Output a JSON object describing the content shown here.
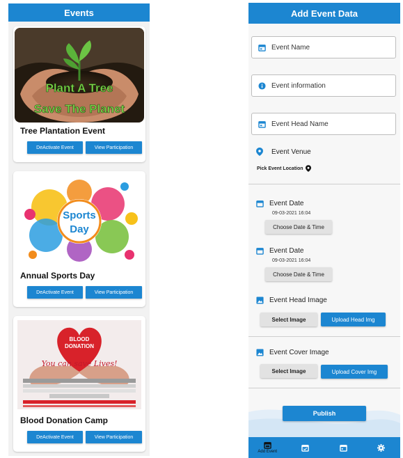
{
  "events_screen": {
    "title": "Events",
    "cards": [
      {
        "title": "Tree Plantation Event",
        "image_text_1": "Plant A Tree",
        "image_text_2": "Save The Planet",
        "deactivate_label": "DeActivate Event",
        "view_label": "View Participation"
      },
      {
        "title": "Annual Sports Day",
        "image_text_1": "Sports",
        "image_text_2": "Day",
        "deactivate_label": "DeActivate Event",
        "view_label": "View Participation"
      },
      {
        "title": "Blood Donation Camp",
        "image_text_1": "BLOOD",
        "image_text_2": "DONATION",
        "image_text_3": "You can save Lives!",
        "deactivate_label": "DeActivate Event",
        "view_label": "View Participation"
      }
    ]
  },
  "add_event": {
    "title": "Add Event Data",
    "fields": {
      "event_name": "Event Name",
      "event_information": "Event information",
      "event_head_name": "Event Head Name"
    },
    "venue": {
      "label": "Event Venue",
      "pick_location": "Pick Event Location"
    },
    "event_date_1": {
      "label": "Event Date",
      "value": "09-03-2021 16:04",
      "button": "Choose Date & Time"
    },
    "event_date_2": {
      "label": "Event Date",
      "value": "09-03-2021 16:04",
      "button": "Choose Date & Time"
    },
    "head_image": {
      "label": "Event Head Image",
      "select": "Select Image",
      "upload": "Upload Head Img"
    },
    "cover_image": {
      "label": "Event Cover Image",
      "select": "Select Image",
      "upload": "Upload Cover Img"
    },
    "publish": "Publish",
    "bottom_nav": [
      {
        "icon": "calendar-plus-icon",
        "label": "Add Event"
      },
      {
        "icon": "calendar-check-icon",
        "label": ""
      },
      {
        "icon": "calendar-icon",
        "label": ""
      },
      {
        "icon": "gear-icon",
        "label": ""
      }
    ]
  },
  "colors": {
    "primary": "#1c86d1",
    "button_grey": "#e2e2e2",
    "background": "#f2f2f2"
  }
}
